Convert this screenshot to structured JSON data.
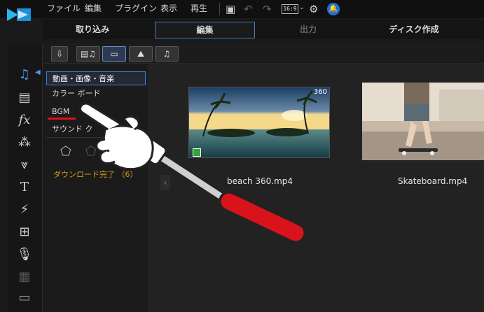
{
  "menu": [
    "ファイル",
    "編集",
    "プラグイン",
    "表示",
    "再生"
  ],
  "toolbar": {
    "ratio": "16:9",
    "notify_glyph": "🔔"
  },
  "modes": {
    "import": "取り込み",
    "edit": "編集",
    "output": "出力",
    "disc": "ディスク作成"
  },
  "categories": {
    "media": "動画・画像・音楽",
    "color_board": "カラー ボード",
    "bgm": "BGM",
    "sound": "サウンド ク"
  },
  "download": "ダウンロード完了 （6）",
  "media": [
    {
      "filename": "beach 360.mp4",
      "badge": "360"
    },
    {
      "filename": "Skateboard.mp4"
    }
  ],
  "colors": {
    "accent": "#3d82cf",
    "underline": "#d8131b",
    "download": "#d4a017",
    "notify": "#1e72d6"
  },
  "left_tools": [
    "media-room-icon",
    "video-clip-icon",
    "fx-icon",
    "particle-icon",
    "sparkle-icon",
    "title-icon",
    "transition-icon",
    "pip-icon",
    "microphone-icon",
    "chapter-icon",
    "subtitle-icon"
  ]
}
